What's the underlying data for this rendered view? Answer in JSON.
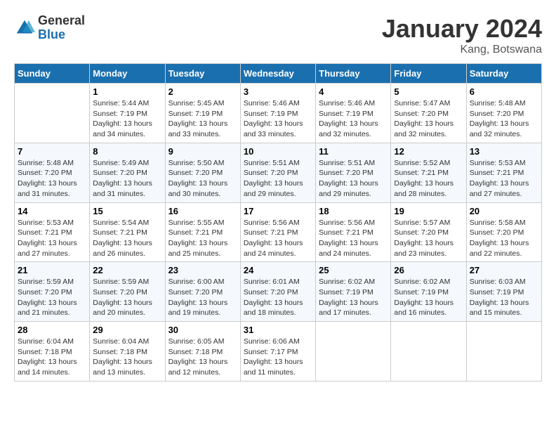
{
  "logo": {
    "general": "General",
    "blue": "Blue"
  },
  "title": "January 2024",
  "subtitle": "Kang, Botswana",
  "days": [
    "Sunday",
    "Monday",
    "Tuesday",
    "Wednesday",
    "Thursday",
    "Friday",
    "Saturday"
  ],
  "weeks": [
    [
      {
        "date": "",
        "sunrise": "",
        "sunset": "",
        "daylight": ""
      },
      {
        "date": "1",
        "sunrise": "Sunrise: 5:44 AM",
        "sunset": "Sunset: 7:19 PM",
        "daylight": "Daylight: 13 hours and 34 minutes."
      },
      {
        "date": "2",
        "sunrise": "Sunrise: 5:45 AM",
        "sunset": "Sunset: 7:19 PM",
        "daylight": "Daylight: 13 hours and 33 minutes."
      },
      {
        "date": "3",
        "sunrise": "Sunrise: 5:46 AM",
        "sunset": "Sunset: 7:19 PM",
        "daylight": "Daylight: 13 hours and 33 minutes."
      },
      {
        "date": "4",
        "sunrise": "Sunrise: 5:46 AM",
        "sunset": "Sunset: 7:19 PM",
        "daylight": "Daylight: 13 hours and 32 minutes."
      },
      {
        "date": "5",
        "sunrise": "Sunrise: 5:47 AM",
        "sunset": "Sunset: 7:20 PM",
        "daylight": "Daylight: 13 hours and 32 minutes."
      },
      {
        "date": "6",
        "sunrise": "Sunrise: 5:48 AM",
        "sunset": "Sunset: 7:20 PM",
        "daylight": "Daylight: 13 hours and 32 minutes."
      }
    ],
    [
      {
        "date": "7",
        "sunrise": "Sunrise: 5:48 AM",
        "sunset": "Sunset: 7:20 PM",
        "daylight": "Daylight: 13 hours and 31 minutes."
      },
      {
        "date": "8",
        "sunrise": "Sunrise: 5:49 AM",
        "sunset": "Sunset: 7:20 PM",
        "daylight": "Daylight: 13 hours and 31 minutes."
      },
      {
        "date": "9",
        "sunrise": "Sunrise: 5:50 AM",
        "sunset": "Sunset: 7:20 PM",
        "daylight": "Daylight: 13 hours and 30 minutes."
      },
      {
        "date": "10",
        "sunrise": "Sunrise: 5:51 AM",
        "sunset": "Sunset: 7:20 PM",
        "daylight": "Daylight: 13 hours and 29 minutes."
      },
      {
        "date": "11",
        "sunrise": "Sunrise: 5:51 AM",
        "sunset": "Sunset: 7:20 PM",
        "daylight": "Daylight: 13 hours and 29 minutes."
      },
      {
        "date": "12",
        "sunrise": "Sunrise: 5:52 AM",
        "sunset": "Sunset: 7:21 PM",
        "daylight": "Daylight: 13 hours and 28 minutes."
      },
      {
        "date": "13",
        "sunrise": "Sunrise: 5:53 AM",
        "sunset": "Sunset: 7:21 PM",
        "daylight": "Daylight: 13 hours and 27 minutes."
      }
    ],
    [
      {
        "date": "14",
        "sunrise": "Sunrise: 5:53 AM",
        "sunset": "Sunset: 7:21 PM",
        "daylight": "Daylight: 13 hours and 27 minutes."
      },
      {
        "date": "15",
        "sunrise": "Sunrise: 5:54 AM",
        "sunset": "Sunset: 7:21 PM",
        "daylight": "Daylight: 13 hours and 26 minutes."
      },
      {
        "date": "16",
        "sunrise": "Sunrise: 5:55 AM",
        "sunset": "Sunset: 7:21 PM",
        "daylight": "Daylight: 13 hours and 25 minutes."
      },
      {
        "date": "17",
        "sunrise": "Sunrise: 5:56 AM",
        "sunset": "Sunset: 7:21 PM",
        "daylight": "Daylight: 13 hours and 24 minutes."
      },
      {
        "date": "18",
        "sunrise": "Sunrise: 5:56 AM",
        "sunset": "Sunset: 7:21 PM",
        "daylight": "Daylight: 13 hours and 24 minutes."
      },
      {
        "date": "19",
        "sunrise": "Sunrise: 5:57 AM",
        "sunset": "Sunset: 7:20 PM",
        "daylight": "Daylight: 13 hours and 23 minutes."
      },
      {
        "date": "20",
        "sunrise": "Sunrise: 5:58 AM",
        "sunset": "Sunset: 7:20 PM",
        "daylight": "Daylight: 13 hours and 22 minutes."
      }
    ],
    [
      {
        "date": "21",
        "sunrise": "Sunrise: 5:59 AM",
        "sunset": "Sunset: 7:20 PM",
        "daylight": "Daylight: 13 hours and 21 minutes."
      },
      {
        "date": "22",
        "sunrise": "Sunrise: 5:59 AM",
        "sunset": "Sunset: 7:20 PM",
        "daylight": "Daylight: 13 hours and 20 minutes."
      },
      {
        "date": "23",
        "sunrise": "Sunrise: 6:00 AM",
        "sunset": "Sunset: 7:20 PM",
        "daylight": "Daylight: 13 hours and 19 minutes."
      },
      {
        "date": "24",
        "sunrise": "Sunrise: 6:01 AM",
        "sunset": "Sunset: 7:20 PM",
        "daylight": "Daylight: 13 hours and 18 minutes."
      },
      {
        "date": "25",
        "sunrise": "Sunrise: 6:02 AM",
        "sunset": "Sunset: 7:19 PM",
        "daylight": "Daylight: 13 hours and 17 minutes."
      },
      {
        "date": "26",
        "sunrise": "Sunrise: 6:02 AM",
        "sunset": "Sunset: 7:19 PM",
        "daylight": "Daylight: 13 hours and 16 minutes."
      },
      {
        "date": "27",
        "sunrise": "Sunrise: 6:03 AM",
        "sunset": "Sunset: 7:19 PM",
        "daylight": "Daylight: 13 hours and 15 minutes."
      }
    ],
    [
      {
        "date": "28",
        "sunrise": "Sunrise: 6:04 AM",
        "sunset": "Sunset: 7:18 PM",
        "daylight": "Daylight: 13 hours and 14 minutes."
      },
      {
        "date": "29",
        "sunrise": "Sunrise: 6:04 AM",
        "sunset": "Sunset: 7:18 PM",
        "daylight": "Daylight: 13 hours and 13 minutes."
      },
      {
        "date": "30",
        "sunrise": "Sunrise: 6:05 AM",
        "sunset": "Sunset: 7:18 PM",
        "daylight": "Daylight: 13 hours and 12 minutes."
      },
      {
        "date": "31",
        "sunrise": "Sunrise: 6:06 AM",
        "sunset": "Sunset: 7:17 PM",
        "daylight": "Daylight: 13 hours and 11 minutes."
      },
      {
        "date": "",
        "sunrise": "",
        "sunset": "",
        "daylight": ""
      },
      {
        "date": "",
        "sunrise": "",
        "sunset": "",
        "daylight": ""
      },
      {
        "date": "",
        "sunrise": "",
        "sunset": "",
        "daylight": ""
      }
    ]
  ]
}
